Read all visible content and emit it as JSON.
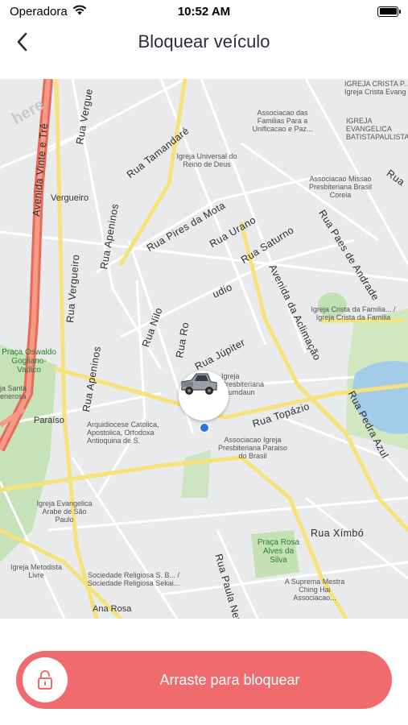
{
  "status_bar": {
    "carrier": "Operadora",
    "time": "10:52 AM"
  },
  "nav": {
    "title": "Bloquear veículo",
    "back_icon": "chevron-left-icon"
  },
  "map": {
    "streets": [
      "Avenida Vinte e Trê",
      "Rua Vergue",
      "Rua Tamandaré",
      "Rua Pires da Mota",
      "Rua Urano",
      "Rua Saturno",
      "Rua Apeninos",
      "Rua Vergueiro",
      "Rua Nilo",
      "Rua Ro",
      "udio",
      "Rua Júpiter",
      "Avenida da Aclimação",
      "Rua Paes de Andrade",
      "Rua Topázio",
      "Rua Apeninos",
      "Rua Pedra Azul",
      "Rua Xímbó",
      "Rua Paula Ney",
      "Rua"
    ],
    "places": [
      "Vergueiro",
      "Praça Oswaldo Gogliano-Vadico",
      "Paraíso",
      "Ana Rosa",
      "Igreja Universal do Reino de Deus",
      "Associacao das Familias Para a Unificacao e Paz...",
      "IGREJA CRISTA P... Igreja Crista Evang",
      "IGREJA EVANGELICA BATISTAPAULISTA",
      "Associacao Missao Presbiteriana Brasil Coreia",
      "Igreja Crista da Familia... / Igreja Crista da Familia",
      "Igreja Presbiteriana Arumdaun",
      "Arquidiocese Catolica, Apostolica, Ortodoxa Antioquina de S.",
      "Associacao Igreja Presbiteriana Paraiso do Brasil",
      "Igreja Evangelica Arabe de São Paulo",
      "Igreja Metodista Livre",
      "Sociedade Religiosa S. B... / Sociedade Religiosa Sekai...",
      "Praça Rosa Alves da Silva",
      "A Suprema Mestra Ching Hai Associacao...",
      "here",
      "ja Santa enerosa"
    ]
  },
  "swipe": {
    "label": "Arraste para bloquear",
    "icon": "unlock-icon"
  },
  "colors": {
    "accent": "#f06b6e",
    "user_dot": "#2f6ee8",
    "map_bg": "#e9eaec",
    "park": "#b9dfa7",
    "water": "#a3cce9",
    "road_major": "#f5e27a"
  }
}
